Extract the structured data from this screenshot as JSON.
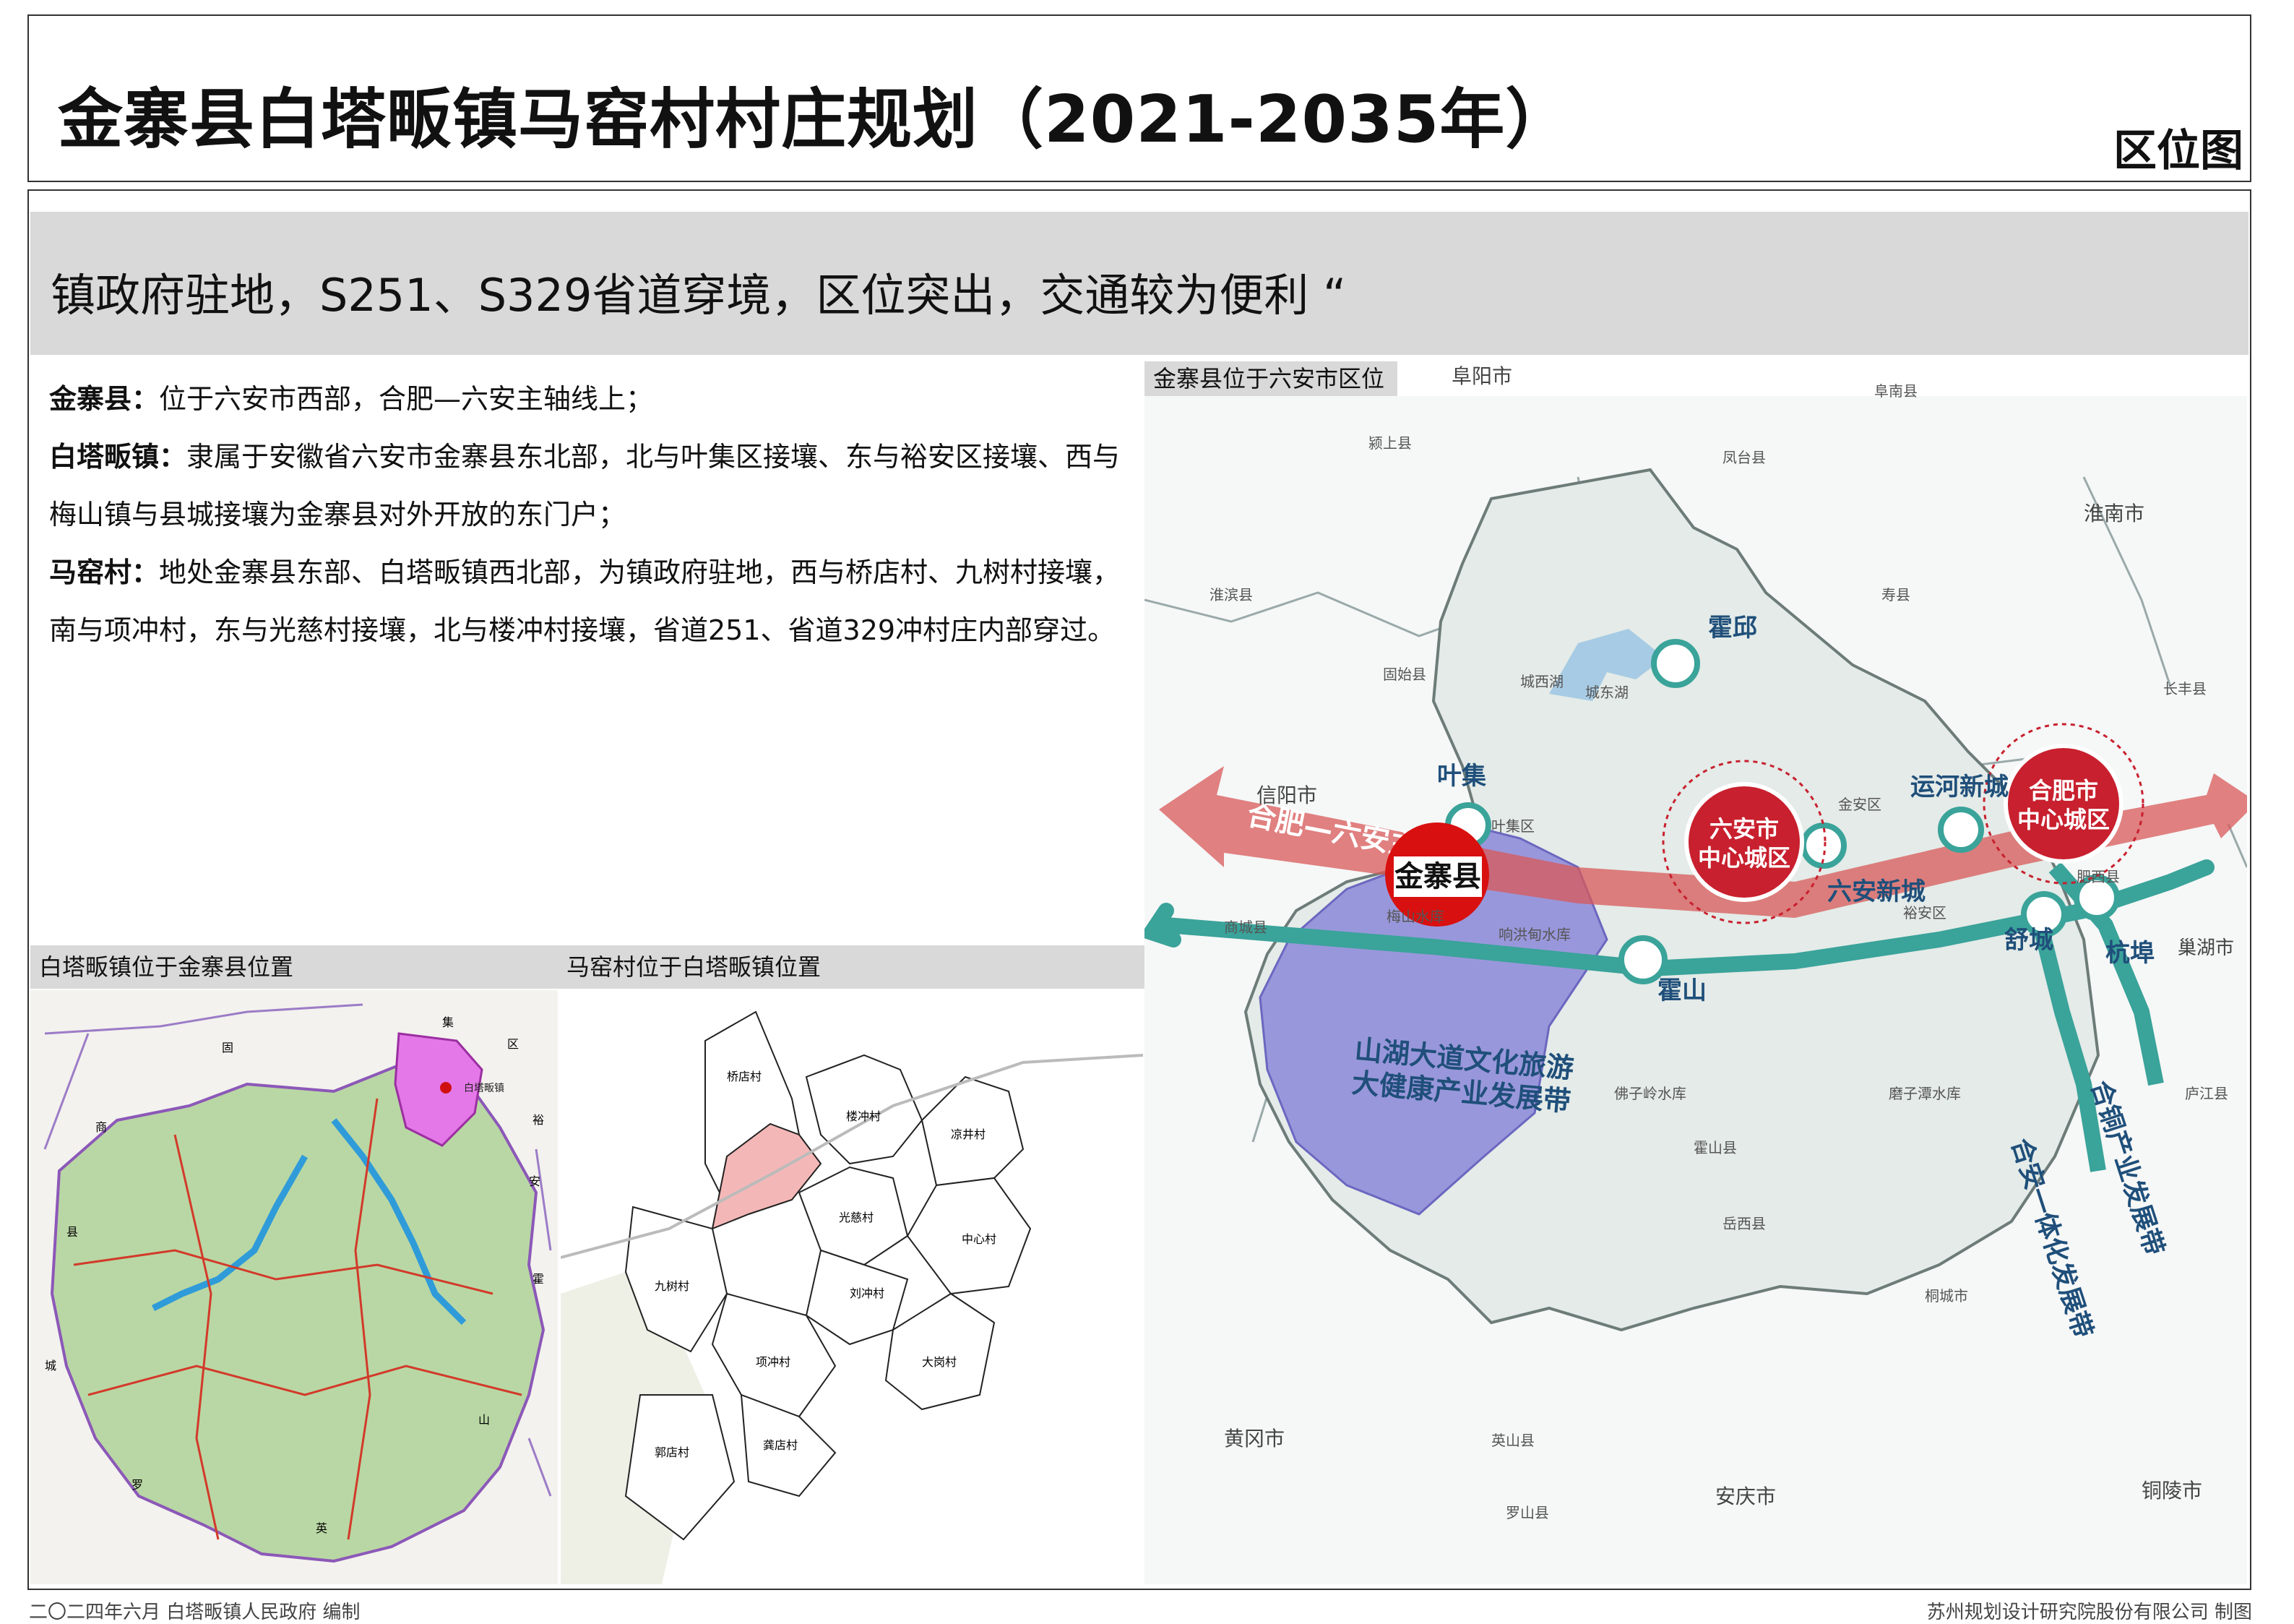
{
  "header": {
    "title": "金寨县白塔畈镇马窑村村庄规划（2021-2035年）",
    "map_type": "区位图"
  },
  "slogan": "镇政府驻地，S251、S329省道穿境，区位突出，交通较为便利 “",
  "description": [
    {
      "term": "金寨县：",
      "text": "位于六安市西部，合肥—六安主轴线上；"
    },
    {
      "term": "白塔畈镇：",
      "text": "隶属于安徽省六安市金寨县东北部，北与叶集区接壤、东与裕安区接壤、西与梅山镇与县城接壤为金寨县对外开放的东门户；"
    },
    {
      "term": "马窑村：",
      "text": "地处金寨县东部、白塔畈镇西北部，为镇政府驻地，西与桥店村、九树村接壤，南与项冲村，东与光慈村接壤，北与楼冲村接壤，省道251、省道329冲村庄内部穿过。"
    }
  ],
  "panels": {
    "county": {
      "title": "白塔畈镇位于金寨县位置",
      "labels": {
        "town": "白塔畈镇",
        "ji": "集",
        "qu": "区",
        "yu": "裕",
        "an": "安",
        "guo": "固",
        "shang": "商",
        "xian": "县",
        "cheng": "城",
        "huo": "霍",
        "shan": "山",
        "luo": "罗",
        "ying": "英"
      }
    },
    "village": {
      "title": "马窑村位于白塔畈镇位置",
      "villages": [
        "桥店村",
        "楼冲村",
        "凉井村",
        "光慈村",
        "九树村",
        "中心村",
        "刘冲村",
        "项冲村",
        "大岗村",
        "龚店村",
        "郭店村"
      ]
    },
    "region": {
      "title": "金寨县位于六安市区位",
      "cities": [
        "阜阳市",
        "淮南市",
        "信阳市",
        "黄冈市",
        "安庆市",
        "铜陵市",
        "巢湖市"
      ],
      "counties": [
        "霍邱",
        "叶集",
        "运河新城",
        "六安新城",
        "舒城",
        "杭埠",
        "霍山",
        "金寨县"
      ],
      "small_labels": [
        "颍上县",
        "凤台县",
        "寿县",
        "长丰县",
        "淮滨县",
        "固始县",
        "商城县",
        "城西湖",
        "城东湖",
        "叶集区",
        "金安区",
        "裕安区",
        "梅山水库",
        "响洪甸水库",
        "佛子岭水库",
        "磨子潭水库",
        "岳西县",
        "英山县",
        "罗山县",
        "桐城市",
        "庐江县",
        "肥西县",
        "阜南县",
        "霍山县"
      ],
      "centers": [
        "六安市\n中心城区",
        "合肥市\n中心城区"
      ],
      "axis_label": "合肥—六安主轴",
      "belt_labels": [
        "山湖大道文化旅游\n大健康产业发展带",
        "合安一体化发展带",
        "合铜产业发展带"
      ]
    }
  },
  "colors": {
    "red": "#c8202e",
    "teal": "#3aa39a",
    "purple": "#7e7ad4",
    "pink": "#e78fe7"
  },
  "footer": {
    "left": "二〇二四年六月  白塔畈镇人民政府  编制",
    "right": "苏州规划设计研究院股份有限公司  制图"
  }
}
